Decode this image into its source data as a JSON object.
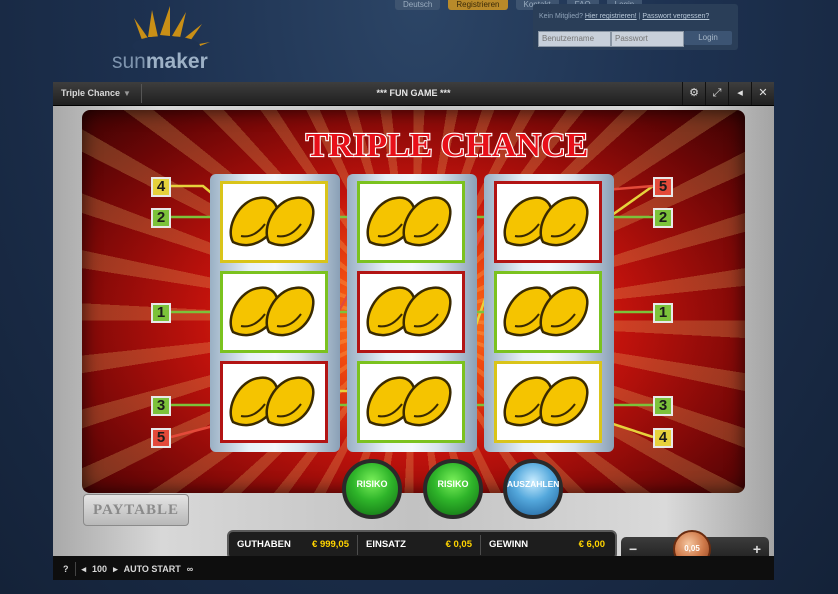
{
  "site": {
    "logo_text_a": "sun",
    "logo_text_b": "maker",
    "topbar": [
      "Deutsch",
      "Registrieren",
      "Kontakt",
      "FAQ",
      "Login"
    ],
    "login_hint": "Kein Mitglied?",
    "login_hint_link": "Hier registrieren!",
    "login_forgot": "Passwort vergessen?",
    "username_placeholder": "Benutzername",
    "password_placeholder": "Passwort",
    "login_button": "Login"
  },
  "window": {
    "game_select": "Triple Chance",
    "mode_title": "*** FUN GAME ***",
    "icons": [
      "gear-icon",
      "fullscreen-icon",
      "sound-icon",
      "close-icon"
    ]
  },
  "game": {
    "title": "TRIPLE CHANCE",
    "symbol": "lemon",
    "left_lines": [
      "4",
      "2",
      "1",
      "3",
      "5"
    ],
    "right_lines": [
      "5",
      "2",
      "1",
      "3",
      "4"
    ],
    "risiko_1": "RISIKO",
    "risiko_2": "RISIKO",
    "auszahlen": "AUSZAHLEN",
    "paytable": "PAYTABLE"
  },
  "stats": {
    "guthaben_label": "GUTHABEN",
    "guthaben_value": "€ 999,05",
    "einsatz_label": "EINSATZ",
    "einsatz_value": "€ 0,05",
    "gewinn_label": "GEWINN",
    "gewinn_value": "€ 6,00"
  },
  "stake": {
    "minus": "−",
    "plus": "+",
    "value": "0,05"
  },
  "footer": {
    "help": "?",
    "autostart_count": "100",
    "autostart_label": "AUTO START"
  },
  "colors": {
    "line_green": "#7cc23a",
    "line_yellow": "#e6d23c",
    "line_red": "#e34a3a",
    "value_yellow": "#ffd400"
  }
}
